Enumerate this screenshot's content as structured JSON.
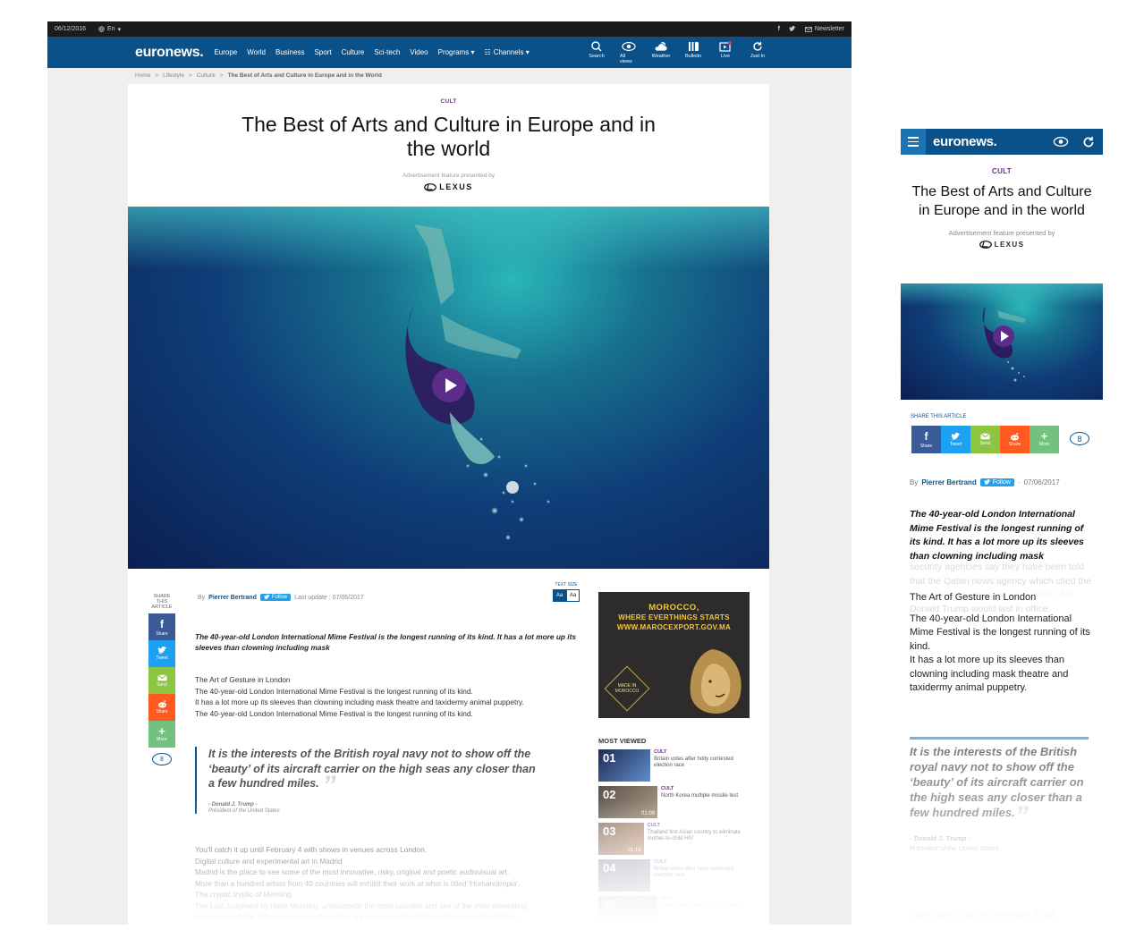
{
  "desktop": {
    "topbar": {
      "date": "06/12/2016",
      "lang": "En",
      "newsletter": "Newsletter"
    },
    "logo": "euronews.",
    "nav": [
      "Europe",
      "World",
      "Business",
      "Sport",
      "Culture",
      "Sci-tech",
      "Video",
      "Programs ▾",
      "Channels ▾"
    ],
    "nav_icons": [
      {
        "label": "Search",
        "icon": "search-icon"
      },
      {
        "label": "All views",
        "icon": "eye-icon"
      },
      {
        "label": "Weather",
        "icon": "weather-icon"
      },
      {
        "label": "Bulletin",
        "icon": "bulletin-icon"
      },
      {
        "label": "Live",
        "icon": "live-icon"
      },
      {
        "label": "Just In",
        "icon": "refresh-icon"
      }
    ],
    "breadcrumb": [
      "Home",
      ">",
      "Lifestyle",
      ">",
      "Culture",
      ">",
      "The Best of Arts and Culture in Europe and in the World"
    ],
    "kicker": "CULT",
    "headline": "The Best of Arts and Culture in Europe and in the world",
    "sponsor_label": "Advertisement feature presented by",
    "sponsor": "LEXUS",
    "share": {
      "label": "SHARE THIS ARTICLE",
      "buttons": [
        "Share",
        "Tweet",
        "Send",
        "Share",
        "More"
      ],
      "count": "8"
    },
    "byline": {
      "prefix": "By",
      "author": "Pierrer Bertrand",
      "follow": "Follow",
      "updated": "Last update : 07/06/2017"
    },
    "text_size": {
      "label": "TEXT SIZE",
      "small": "Aa",
      "large": "Aa"
    },
    "lede": "The 40-year-old London International Mime Festival is the longest running of its kind. It has a lot more up its sleeves than clowning including mask",
    "body1": [
      "The Art of Gesture in London",
      "The 40-year-old London International Mime Festival is the longest running of its kind.",
      "It has a lot more up its sleeves than clowning including mask theatre and taxidermy animal puppetry.",
      "The 40-year-old London International Mime Festival is the longest running of its kind."
    ],
    "quote": {
      "text": "It is the interests of the British royal navy not to show off the ‘beauty’ of its aircraft carrier on the high seas any closer than a few hundred miles.",
      "author": "- Donald J. Trump -",
      "role": "Président of the United States"
    },
    "body2": [
      "You'll catch it up until February 4 with shows in venues across London.",
      "Digital culture and experimental art in Madrid",
      "Madrid is the place to see some of the most innovative, risky, original and poetic audiovisual art.",
      "More than a hundred artists from 40 countries will exhibit their work at what is titled 'Humanotropia'.",
      "The cryptic tryptic of Memling",
      "The Last Judgment by Hans Memling, undoubtedly the most valuable and one of the most interesting",
      "pieces of art in the Gdańsk museums collection are on show at the National Museum in the Tallinn..."
    ],
    "ad": {
      "line1": "MOROCCO,",
      "line2": "WHERE EVERTHINGS STARTS",
      "line3": "WWW.MAROCEXPORT.GOV.MA",
      "badge": "MADE IN MOROCCO"
    },
    "most_viewed": {
      "title": "MOST VIEWED",
      "items": [
        {
          "num": "01",
          "kicker": "CULT",
          "title": "Britain votes after hotly contested election race"
        },
        {
          "num": "02",
          "kicker": "CULT",
          "title": "North Korea multiple missile test",
          "duration": "01:09"
        },
        {
          "num": "03",
          "kicker": "CULT",
          "title": "Thailand first Asian country to eliminate mother-to-child HIV",
          "duration": "01:15"
        },
        {
          "num": "04",
          "kicker": "CULT",
          "title": "Britain votes after hotly contested election race"
        },
        {
          "num": "05",
          "kicker": "CULT",
          "title": "North Korea multiple missile test"
        }
      ]
    }
  },
  "mobile": {
    "logo": "euronews.",
    "kicker": "CULT",
    "headline": "The Best of Arts and Culture in Europe and in the world",
    "sponsor_label": "Advertisement feature presented by",
    "sponsor": "LEXUS",
    "share_label": "SHARE THIS ARTICLE",
    "share_buttons": [
      "Share",
      "Tweet",
      "Send",
      "Share",
      "More"
    ],
    "count": "8",
    "byline": {
      "prefix": "By",
      "author": "Pierrer Bertrand",
      "follow": "Follow",
      "date": "07/06/2017"
    },
    "lede": "The 40-year-old London International Mime Festival is the longest running of its kind. It has a lot more up its sleeves than clowning including mask",
    "ghost_text": "security agencies say they have been told that the Qatari news agency which cited the Emir of Qatar made the comments after Donald Trump would last in office.",
    "body": [
      "The Art of Gesture in London",
      "The 40-year-old London International Mime Festival is the longest running of its kind.",
      "It has a lot more up its sleeves than clowning including mask theatre and taxidermy animal puppetry."
    ],
    "quote": {
      "text": "It is the interests of the British royal navy not to show off the ‘beauty’ of its aircraft carrier on the high seas any closer than a few hundred miles.",
      "author": "- Donald J. Trump -",
      "role": "Président of the United States"
    },
    "body2": "You'll catch it up until February 4 with"
  },
  "colors": {
    "brand": "#0a5189",
    "kicker": "#6a2f8a",
    "play": "#5b2c8a"
  }
}
